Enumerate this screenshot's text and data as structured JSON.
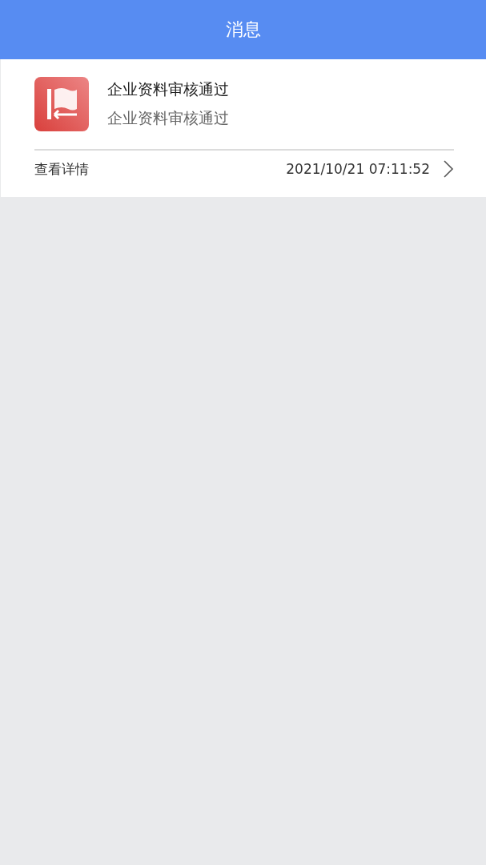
{
  "header": {
    "title": "消息"
  },
  "messages": [
    {
      "title": "企业资料审核通过",
      "body": "企业资料审核通过",
      "link": "查看详情",
      "time": "2021/10/21 07:11:52"
    }
  ]
}
